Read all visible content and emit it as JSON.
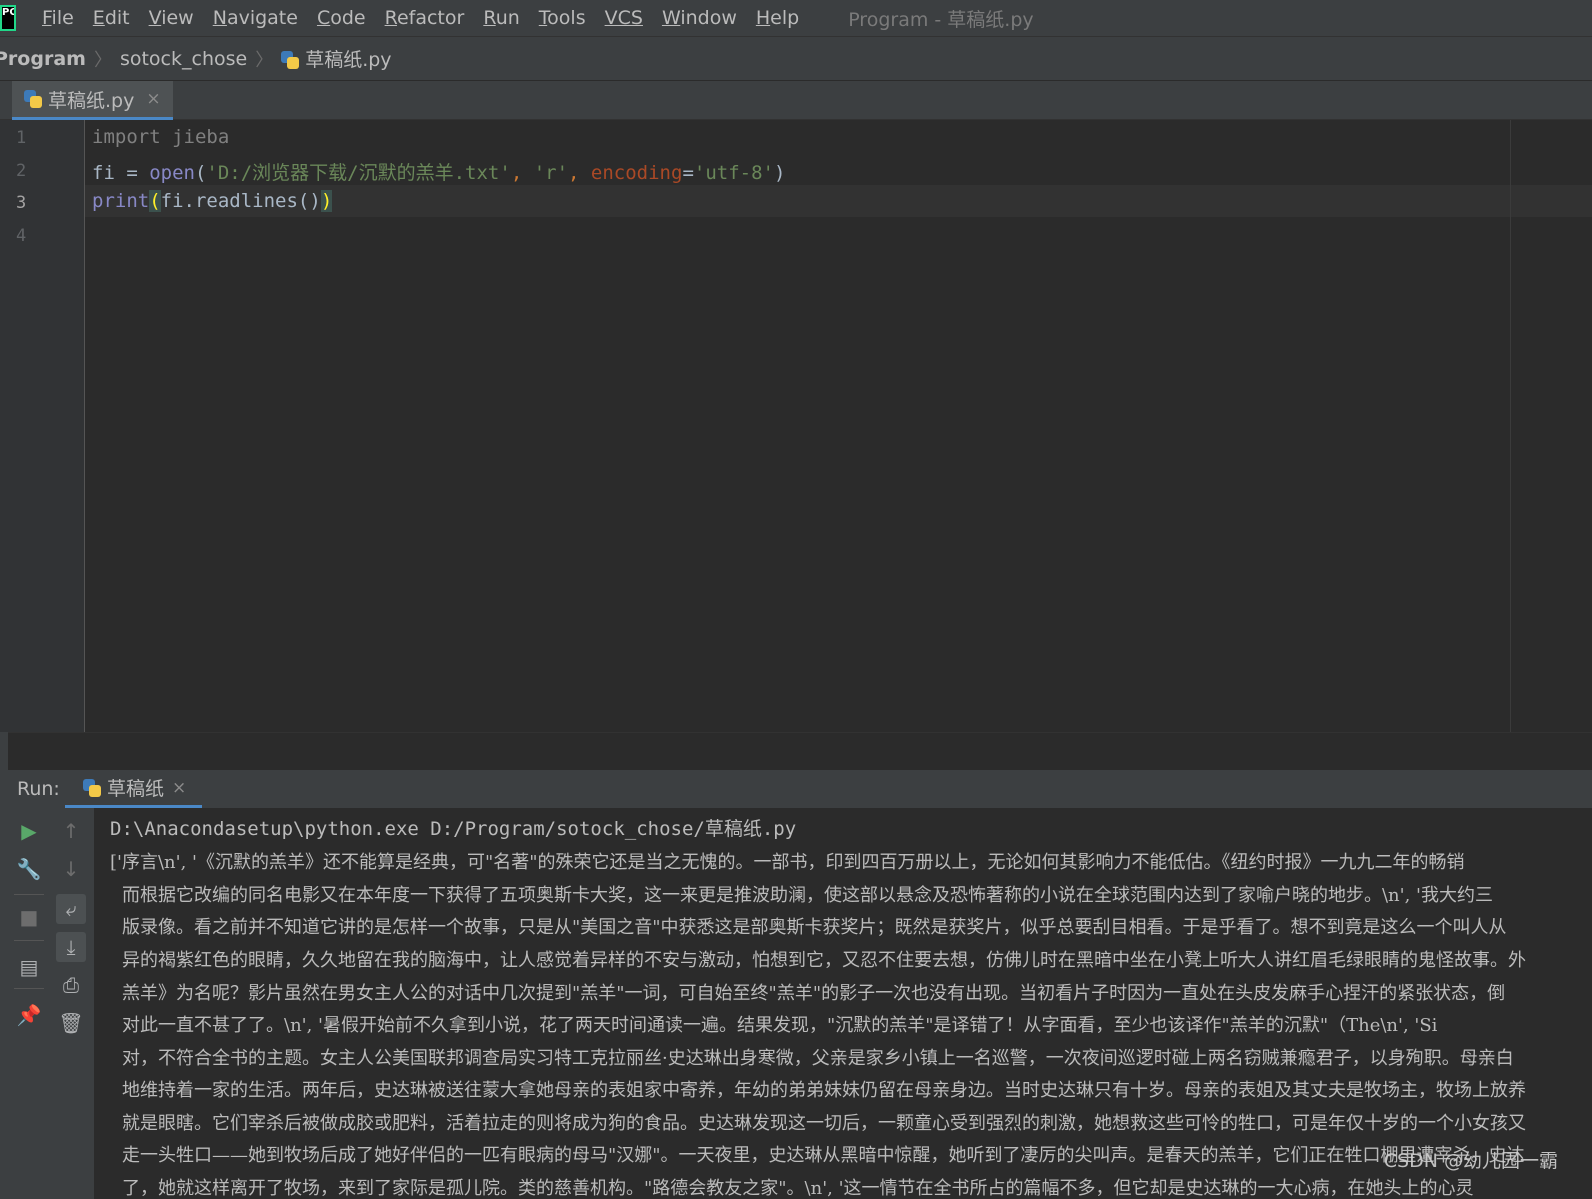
{
  "menu": {
    "logo_text": "PC",
    "items": [
      {
        "underline": "F",
        "rest": "ile"
      },
      {
        "underline": "E",
        "rest": "dit"
      },
      {
        "underline": "V",
        "rest": "iew"
      },
      {
        "underline": "N",
        "rest": "avigate"
      },
      {
        "underline": "C",
        "rest": "ode"
      },
      {
        "underline": "R",
        "rest": "efactor"
      },
      {
        "underline": "R",
        "rest": "un"
      },
      {
        "underline": "T",
        "rest": "ools"
      },
      {
        "underline": "VCS",
        "rest": ""
      },
      {
        "underline": "W",
        "rest": "indow"
      },
      {
        "underline": "H",
        "rest": "elp"
      }
    ],
    "window_title": "Program - 草稿纸.py"
  },
  "breadcrumb": {
    "project": "Program",
    "folder": "sotock_chose",
    "file": "草稿纸.py",
    "separator": "〉"
  },
  "editor_tab": {
    "label": "草稿纸.py",
    "close": "×"
  },
  "editor": {
    "line_numbers": [
      "1",
      "2",
      "3",
      "4"
    ],
    "line1": {
      "kw": "import",
      "sp": " ",
      "mod": "jieba"
    },
    "line2": {
      "var": "fi = ",
      "fn": "open",
      "p1": "(",
      "s1": "'D:/浏览器下载/沉默的羔羊.txt'",
      "comma1": ", ",
      "s2": "'r'",
      "comma2": ", ",
      "param": "encoding",
      "eq": "=",
      "s3": "'utf-8'",
      "p2": ")"
    },
    "line3": {
      "fn": "print",
      "open": "(",
      "mid": "fi.readlines()",
      "close": ")"
    }
  },
  "run_panel": {
    "label": "Run:",
    "tab_label": "草稿纸",
    "close": "×",
    "command": "D:\\Anacondasetup\\python.exe D:/Program/sotock_chose/草稿纸.py",
    "output": [
      "['序言\\n', '《沉默的羔羊》还不能算是经典，可\"名著\"的殊荣它还是当之无愧的。一部书，印到四百万册以上，无论如何其影响力不能低估。《纽约时报》一九九二年的畅销",
      "而根据它改编的同名电影又在本年度一下获得了五项奥斯卡大奖，这一来更是推波助澜，使这部以悬念及恐怖著称的小说在全球范围内达到了家喻户晓的地步。\\n', '我大约三",
      "版录像。看之前并不知道它讲的是怎样一个故事，只是从\"美国之音\"中获悉这是部奥斯卡获奖片；既然是获奖片，似乎总要刮目相看。于是乎看了。想不到竟是这么一个叫人从",
      "异的褐紫红色的眼睛，久久地留在我的脑海中，让人感觉着异样的不安与激动，怕想到它，又忍不住要去想，仿佛儿时在黑暗中坐在小凳上听大人讲红眉毛绿眼睛的鬼怪故事。外",
      "羔羊》为名呢？影片虽然在男女主人公的对话中几次提到\"羔羊\"一词，可自始至终\"羔羊\"的影子一次也没有出现。当初看片子时因为一直处在头皮发麻手心捏汗的紧张状态，倒",
      "对此一直不甚了了。\\n', '暑假开始前不久拿到小说，花了两天时间通读一遍。结果发现，\"沉默的羔羊\"是译错了！从字面看，至少也该译作\"羔羊的沉默\"（The\\n', 'Si",
      "对，不符合全书的主题。女主人公美国联邦调查局实习特工克拉丽丝·史达琳出身寒微，父亲是家乡小镇上一名巡警，一次夜间巡逻时碰上两名窃贼兼瘾君子，以身殉职。母亲白",
      "地维持着一家的生活。两年后，史达琳被送往蒙大拿她母亲的表姐家中寄养，年幼的弟弟妹妹仍留在母亲身边。当时史达琳只有十岁。母亲的表姐及其丈夫是牧场主，牧场上放养",
      "就是眼瞎。它们宰杀后被做成胶或肥料，活着拉走的则将成为狗的食品。史达琳发现这一切后，一颗童心受到强烈的刺激，她想救这些可怜的牲口，可是年仅十岁的一个小女孩又",
      "走一头牲口——她到牧场后成了她好伴侣的一匹有眼病的母马\"汉娜\"。一天夜里，史达琳从黑暗中惊醒，她听到了凄厉的尖叫声。是春天的羔羊，它们正在牲口棚里遭宰杀。史达",
      "了，她就这样离开了牧场，来到了家际是孤儿院。类的慈善机构。\"路德会教友之家\"。\\n', '这一情节在全书所占的篇幅不多，但它却是史达琳的一大心病，在她头上的心灵"
    ]
  },
  "watermark": "CSDN @幼儿园一霸"
}
